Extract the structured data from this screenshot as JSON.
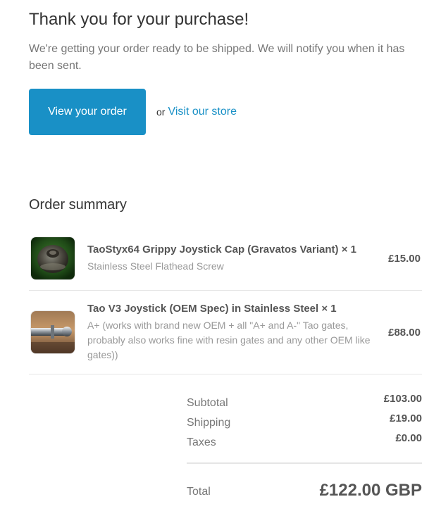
{
  "header": {
    "title": "Thank you for your purchase!",
    "subtitle": "We're getting your order ready to be shipped. We will notify you when it has been sent."
  },
  "actions": {
    "view_order_label": "View your order",
    "or_text": "or",
    "visit_store_label": "Visit our store",
    "accent_color": "#1990c6"
  },
  "summary": {
    "title": "Order summary",
    "items": [
      {
        "name": "TaoStyx64 Grippy Joystick Cap (Gravatos Variant) × 1",
        "variant": "Stainless Steel Flathead Screw",
        "price": "£15.00",
        "image_icon": "joystick-cap-photo"
      },
      {
        "name": "Tao V3 Joystick (OEM Spec) in Stainless Steel × 1",
        "variant": "A+ (works with brand new OEM + all \"A+ and A-\" Tao gates, probably also works fine with resin gates and any other OEM like gates))",
        "price": "£88.00",
        "image_icon": "joystick-shaft-photo"
      }
    ]
  },
  "totals": {
    "subtotal_label": "Subtotal",
    "subtotal_value": "£103.00",
    "shipping_label": "Shipping",
    "shipping_value": "£19.00",
    "taxes_label": "Taxes",
    "taxes_value": "£0.00",
    "total_label": "Total",
    "total_value": "£122.00 GBP"
  }
}
